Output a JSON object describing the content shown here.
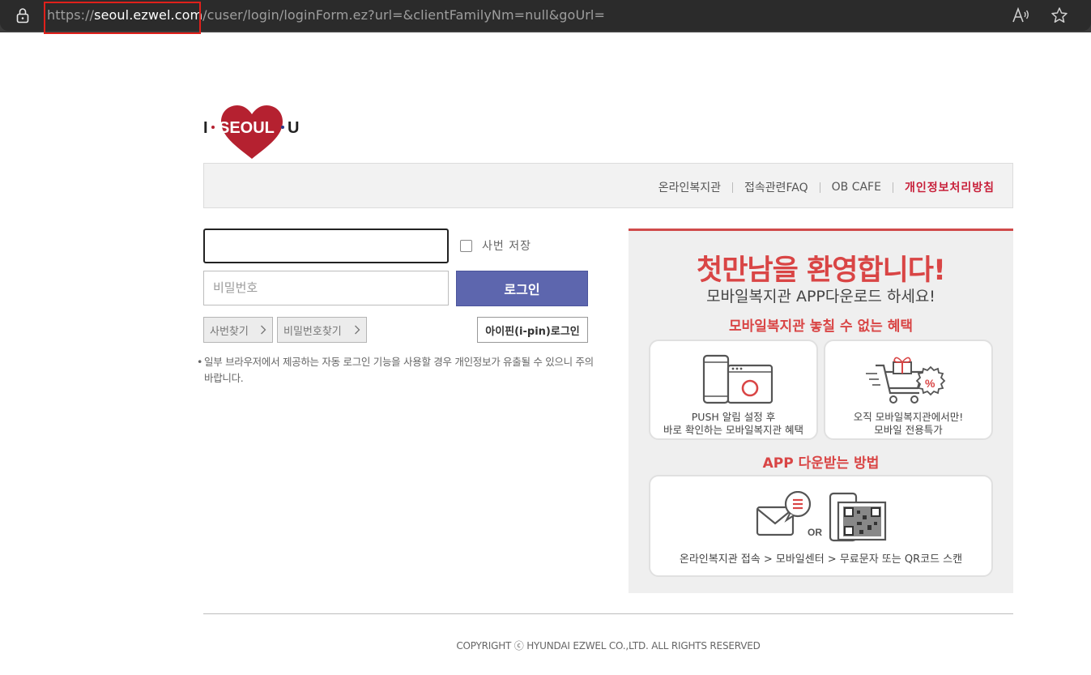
{
  "browser": {
    "url_scheme": "https://",
    "url_host": "seoul.ezwel.com",
    "url_path": "/cuser/login/loginForm.ez?url=&clientFamilyNm=null&goUrl=",
    "highlight_color": "#e0201b"
  },
  "logo": {
    "text_left": "I",
    "text_main": "SEOUL",
    "text_right": "U",
    "heart_color": "#b52130"
  },
  "topnav": {
    "items": [
      {
        "label": "온라인복지관"
      },
      {
        "label": "접속관련FAQ"
      },
      {
        "label": "OB CAFE"
      },
      {
        "label": "개인정보처리방침"
      }
    ],
    "privacy_color": "#c8203a"
  },
  "login": {
    "id_value": "",
    "save_label": "사번 저장",
    "password_placeholder": "비밀번호",
    "login_button": "로그인",
    "find_id_button": "사번찾기",
    "find_pw_button": "비밀번호찾기",
    "ipin_button": "아이핀(i-pin)로그인",
    "notice": "일부 브라우저에서 제공하는 자동 로그인 기능을 사용할 경우 개인정보가 유출될 수 있으니 주의 바랍니다.",
    "button_color": "#5d66ae"
  },
  "banner": {
    "title": "첫만남을 환영합니다!",
    "subtitle": "모바일복지관 APP다운로드 하세요!",
    "benefit_heading": "모바일복지관 놓칠 수 없는 혜택",
    "card1_line1": "PUSH 알림 설정 후",
    "card1_line2": "바로 확인하는 모바일복지관 혜택",
    "card2_line1": "오직 모바일복지관에서만!",
    "card2_line2": "모바일 전용특가",
    "howto_heading": "APP 다운받는 방법",
    "or_label": "OR",
    "howto_steps": "온라인복지관 접속 > 모바일센터 > 무료문자 또는 QR코드 스캔",
    "accent_color": "#d94545"
  },
  "footer": {
    "copyright": "COPYRIGHT ⓒ HYUNDAI EZWEL CO.,LTD. ALL RIGHTS RESERVED"
  }
}
